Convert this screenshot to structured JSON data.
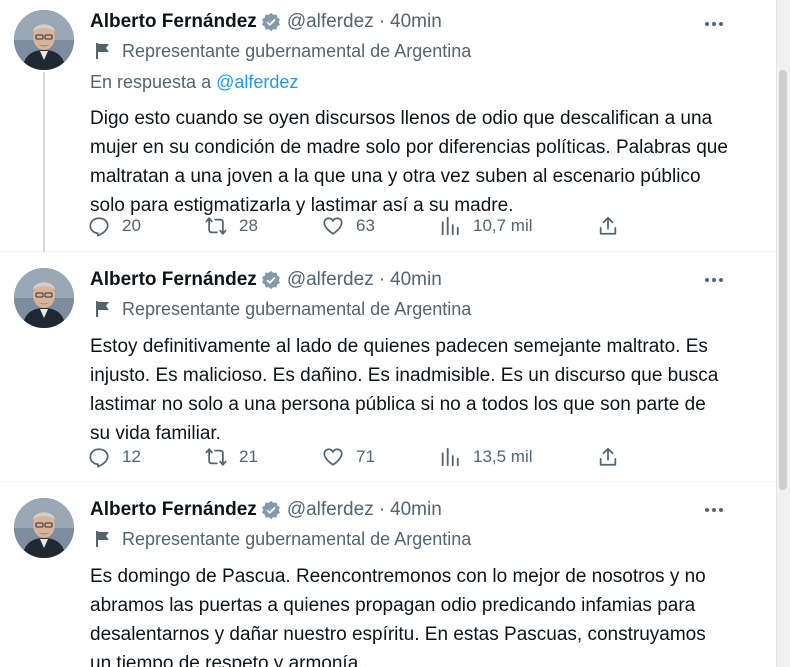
{
  "tweets": [
    {
      "author_name": "Alberto Fernández",
      "handle": "@alferdez",
      "separator": "·",
      "time": "40min",
      "affiliation": "Representante gubernamental de Argentina",
      "reply_prefix": "En respuesta a",
      "reply_handle": "@alferdez",
      "text": "Digo esto cuando se oyen discursos llenos de odio que descalifican a una mujer en su condición de madre solo por diferencias políticas. Palabras que maltratan a una joven a la que una y otra vez suben al escenario público solo para estigmatizarla y lastimar así a su madre.",
      "replies": "20",
      "retweets": "28",
      "likes": "63",
      "views": "10,7 mil"
    },
    {
      "author_name": "Alberto Fernández",
      "handle": "@alferdez",
      "separator": "·",
      "time": "40min",
      "affiliation": "Representante gubernamental de Argentina",
      "text": "Estoy definitivamente al lado de quienes padecen semejante maltrato. Es injusto. Es malicioso. Es dañino. Es inadmisible. Es un discurso que busca lastimar no solo a una persona pública si no a todos los que son parte de su vida familiar.",
      "replies": "12",
      "retweets": "21",
      "likes": "71",
      "views": "13,5 mil"
    },
    {
      "author_name": "Alberto Fernández",
      "handle": "@alferdez",
      "separator": "·",
      "time": "40min",
      "affiliation": "Representante gubernamental de Argentina",
      "text": "Es domingo de Pascua. Reencontremonos con lo mejor de nosotros y no abramos las puertas a quienes propagan  odio predicando infamias para desalentarnos y dañar nuestro espíritu. En estas Pascuas, construyamos un tiempo de respeto y armonía."
    }
  ],
  "icons": {
    "verified": "verified-badge-icon",
    "affiliation": "flag-icon",
    "more": "more-options-icon",
    "reply": "reply-icon",
    "retweet": "retweet-icon",
    "like": "heart-icon",
    "views": "views-chart-icon",
    "share": "share-icon"
  },
  "colors": {
    "text": "#0f1419",
    "secondary": "#536471",
    "link": "#1d9bf0",
    "verified": "#829aab",
    "thread_line": "#cfd9de"
  }
}
